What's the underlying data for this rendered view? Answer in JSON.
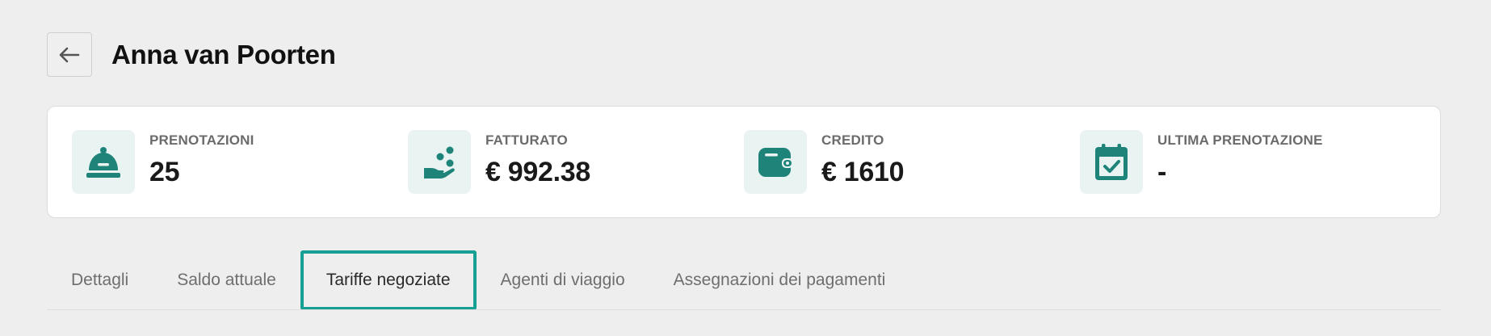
{
  "header": {
    "title": "Anna van Poorten"
  },
  "stats": [
    {
      "label": "PRENOTAZIONI",
      "value": "25",
      "icon": "concierge-bell-icon"
    },
    {
      "label": "FATTURATO",
      "value": "€ 992.38",
      "icon": "hand-coins-icon"
    },
    {
      "label": "CREDITO",
      "value": "€ 1610",
      "icon": "wallet-icon"
    },
    {
      "label": "ULTIMA PRENOTAZIONE",
      "value": "-",
      "icon": "calendar-check-icon"
    }
  ],
  "tabs": [
    {
      "label": "Dettagli",
      "active": false
    },
    {
      "label": "Saldo attuale",
      "active": false
    },
    {
      "label": "Tariffe negoziate",
      "active": true
    },
    {
      "label": "Agenti di viaggio",
      "active": false
    },
    {
      "label": "Assegnazioni dei pagamenti",
      "active": false
    }
  ],
  "colors": {
    "accent": "#1e8379",
    "icon_bg": "#e8f3f2",
    "active_tab_border": "#16a093"
  }
}
